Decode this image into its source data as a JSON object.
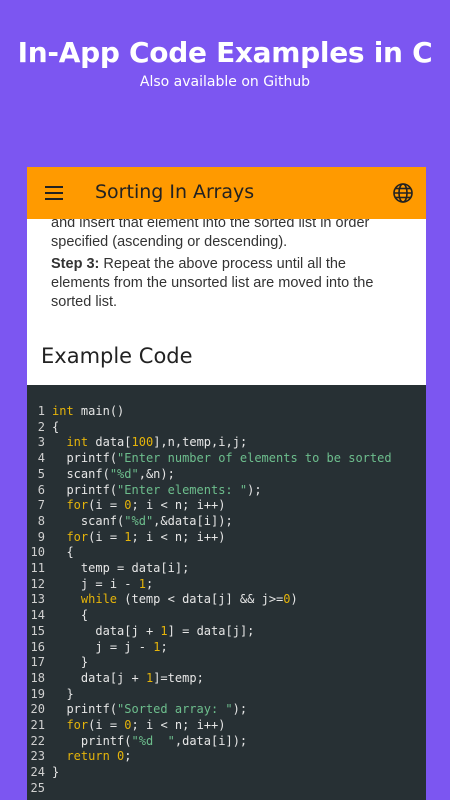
{
  "promo": {
    "title": "In-App Code Examples in C",
    "subtitle": "Also available on Github"
  },
  "appbar": {
    "title": "Sorting In Arrays",
    "menu_icon": "hamburger-menu-icon",
    "language_icon": "globe-icon"
  },
  "content": {
    "para1": "and insert that element into the sorted list in order specified (ascending or descending).",
    "step3_label": "Step 3:",
    "step3_text": " Repeat the above process until all the elements from the unsorted list are moved into the sorted list.",
    "section_title": "Example Code"
  },
  "code": {
    "lines": [
      [
        "int main()"
      ],
      [
        "{"
      ],
      [
        "  int data[100],n,temp,i,j;"
      ],
      [
        "  printf(\"Enter number of elements to be sorted"
      ],
      [
        "  scanf(\"%d\",&n);"
      ],
      [
        "  printf(\"Enter elements: \");"
      ],
      [
        "  for(i = 0; i < n; i++)"
      ],
      [
        "    scanf(\"%d\",&data[i]);"
      ],
      [
        "  for(i = 1; i < n; i++)"
      ],
      [
        "  {"
      ],
      [
        "    temp = data[i];"
      ],
      [
        "    j = i - 1;"
      ],
      [
        "    while (temp < data[j] && j>=0)"
      ],
      [
        "    {"
      ],
      [
        "      data[j + 1] = data[j];"
      ],
      [
        "      j = j - 1;"
      ],
      [
        "    }"
      ],
      [
        "    data[j + 1]=temp;"
      ],
      [
        "  }"
      ],
      [
        "  printf(\"Sorted array: \");"
      ],
      [
        "  for(i = 0; i < n; i++)"
      ],
      [
        "    printf(\"%d  \",data[i]);"
      ],
      [
        "  return 0;"
      ],
      [
        "}"
      ],
      [
        ""
      ]
    ]
  },
  "colors": {
    "background": "#7c56f1",
    "appbar": "#ff9a00",
    "code_bg": "#273034",
    "keyword": "#e5b40a",
    "string": "#6dbe8d"
  }
}
